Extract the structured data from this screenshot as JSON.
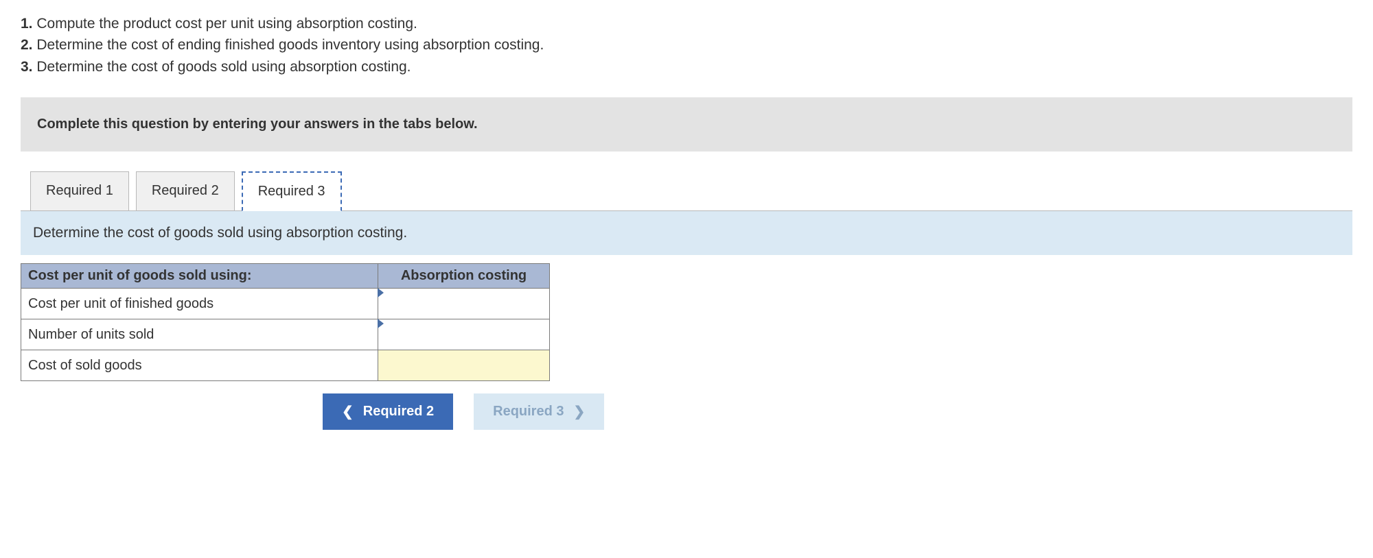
{
  "questions": [
    {
      "num": "1.",
      "text": "Compute the product cost per unit using absorption costing."
    },
    {
      "num": "2.",
      "text": "Determine the cost of ending finished goods inventory using absorption costing."
    },
    {
      "num": "3.",
      "text": "Determine the cost of goods sold using absorption costing."
    }
  ],
  "instruction": "Complete this question by entering your answers in the tabs below.",
  "tabs": [
    {
      "label": "Required 1",
      "active": false
    },
    {
      "label": "Required 2",
      "active": false
    },
    {
      "label": "Required 3",
      "active": true
    }
  ],
  "tab_prompt": "Determine the cost of goods sold using absorption costing.",
  "table": {
    "header_left": "Cost per unit of goods sold using:",
    "header_right": "Absorption costing",
    "rows": [
      {
        "label": "Cost per unit of finished goods",
        "value": "",
        "marker": true,
        "highlight": false
      },
      {
        "label": "Number of units sold",
        "value": "",
        "marker": true,
        "highlight": false
      },
      {
        "label": "Cost of sold goods",
        "value": "",
        "marker": false,
        "highlight": true
      }
    ]
  },
  "nav": {
    "prev_label": "Required 2",
    "next_label": "Required 3"
  }
}
